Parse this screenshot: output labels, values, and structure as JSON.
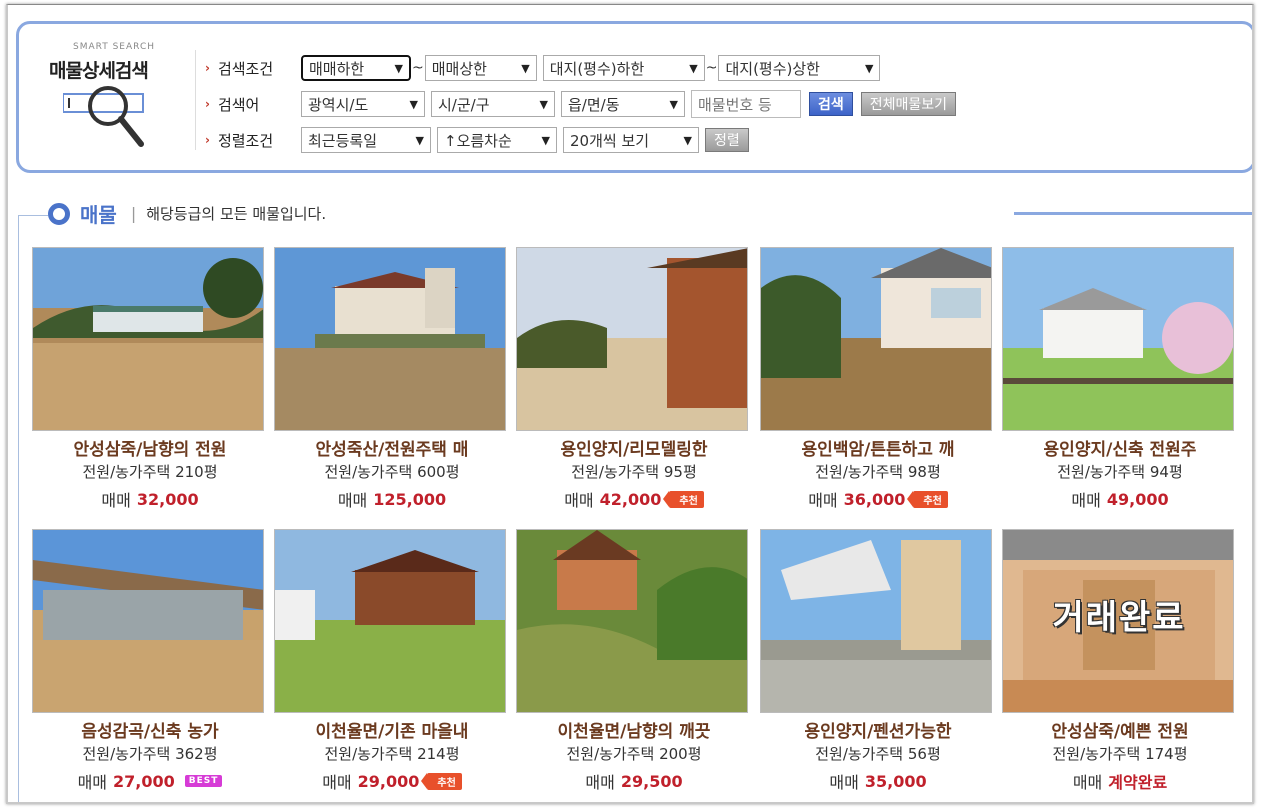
{
  "search_panel": {
    "smart_label": "SMART SEARCH",
    "title": "매물상세검색",
    "rows": {
      "condition": {
        "label": "검색조건",
        "selects": [
          "매매하한",
          "매매상한",
          "대지(평수)하한",
          "대지(평수)상한"
        ],
        "tilde": "~"
      },
      "keyword": {
        "label": "검색어",
        "selects": [
          "광역시/도",
          "시/군/구",
          "읍/면/동"
        ],
        "input_placeholder": "매물번호 등",
        "search_button": "검색",
        "view_all_button": "전체매물보기"
      },
      "sort": {
        "label": "정렬조건",
        "selects": [
          "최근등록일",
          "↑오름차순",
          "20개씩 보기"
        ],
        "sort_button": "정렬"
      }
    }
  },
  "section": {
    "title": "매물",
    "separator": "|",
    "description": "해당등급의 모든 매물입니다."
  },
  "colors": {
    "accent_blue": "#4a73c9",
    "price_red": "#c0202b",
    "title_brown": "#6b3a1f",
    "badge_orange": "#e8502b",
    "badge_magenta": "#d63bd6"
  },
  "listings": [
    {
      "title": "안성삼죽/남향의 전원",
      "type": "전원/농가주택 210평",
      "price_label": "매매",
      "price": "32,000",
      "badge": ""
    },
    {
      "title": "안성죽산/전원주택 매",
      "type": "전원/농가주택 600평",
      "price_label": "매매",
      "price": "125,000",
      "badge": ""
    },
    {
      "title": "용인양지/리모델링한",
      "type": "전원/농가주택 95평",
      "price_label": "매매",
      "price": "42,000",
      "badge": "추천"
    },
    {
      "title": "용인백암/튼튼하고 깨",
      "type": "전원/농가주택 98평",
      "price_label": "매매",
      "price": "36,000",
      "badge": "추천"
    },
    {
      "title": "용인양지/신축 전원주",
      "type": "전원/농가주택 94평",
      "price_label": "매매",
      "price": "49,000",
      "badge": ""
    },
    {
      "title": "음성감곡/신축 농가",
      "type": "전원/농가주택 362평",
      "price_label": "매매",
      "price": "27,000",
      "badge": "BEST"
    },
    {
      "title": "이천율면/기존 마을내",
      "type": "전원/농가주택 214평",
      "price_label": "매매",
      "price": "29,000",
      "badge": "추천"
    },
    {
      "title": "이천율면/남향의 깨끗",
      "type": "전원/농가주택 200평",
      "price_label": "매매",
      "price": "29,500",
      "badge": ""
    },
    {
      "title": "용인양지/펜션가능한",
      "type": "전원/농가주택 56평",
      "price_label": "매매",
      "price": "35,000",
      "badge": ""
    },
    {
      "title": "안성삼죽/예쁜 전원",
      "type": "전원/농가주택 174평",
      "price_label": "매매",
      "price": "계약완료",
      "badge": "",
      "photo_overlay": "거래완료"
    }
  ]
}
